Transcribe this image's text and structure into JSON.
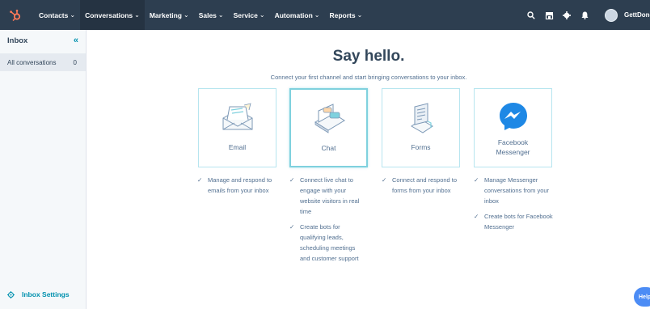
{
  "nav": {
    "items": [
      {
        "label": "Contacts",
        "caret": "⌄"
      },
      {
        "label": "Conversations",
        "caret": "⌄"
      },
      {
        "label": "Marketing",
        "caret": "⌄"
      },
      {
        "label": "Sales",
        "caret": "⌄"
      },
      {
        "label": "Service",
        "caret": "⌄"
      },
      {
        "label": "Automation",
        "caret": "⌄"
      },
      {
        "label": "Reports",
        "caret": "⌄"
      }
    ],
    "account_name": "GettDone",
    "brand_color": "#ff7a59"
  },
  "sidebar": {
    "title": "Inbox",
    "collapse": "«",
    "items": [
      {
        "label": "All conversations",
        "count": "0"
      }
    ],
    "settings_label": "Inbox Settings"
  },
  "main": {
    "title": "Say hello.",
    "subtitle": "Connect your first channel and start bringing conversations to your inbox.",
    "channels": [
      {
        "label": "Email",
        "icon": "email-illustration",
        "features": [
          "Manage and respond to emails from your inbox"
        ]
      },
      {
        "label": "Chat",
        "icon": "chat-illustration",
        "features": [
          "Connect live chat to engage with your website visitors in real time",
          "Create bots for qualifying leads, scheduling meetings and customer support"
        ]
      },
      {
        "label": "Forms",
        "icon": "forms-illustration",
        "features": [
          "Connect and respond to forms from your inbox"
        ]
      },
      {
        "label": "Facebook Messenger",
        "icon": "messenger-icon",
        "features": [
          "Manage Messenger conversations from your inbox",
          "Create bots for Facebook Messenger"
        ]
      }
    ],
    "check": "✓"
  },
  "help_label": "Help"
}
